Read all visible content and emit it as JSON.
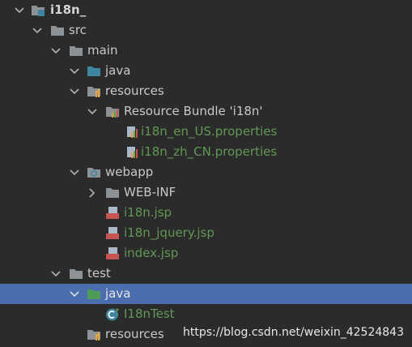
{
  "project_tree": {
    "root": "i18n_",
    "src": "src",
    "main": "main",
    "main_java": "java",
    "main_resources": "resources",
    "bundle": "Resource Bundle 'i18n'",
    "bundle_en": "i18n_en_US.properties",
    "bundle_zh": "i18n_zh_CN.properties",
    "webapp": "webapp",
    "web_inf": "WEB-INF",
    "jsp_i18n": "i18n.jsp",
    "jsp_jquery": "i18n_jquery.jsp",
    "jsp_index": "index.jsp",
    "test": "test",
    "test_java": "java",
    "test_class": "I18nTest",
    "test_resources": "resources",
    "jsp_badge": "JSP"
  },
  "watermark": "https://blog.csdn.net/weixin_42524843",
  "colors": {
    "background": "#2b2b2b",
    "selection": "#4b6eaf",
    "text": "#c8c8c8",
    "file_green": "#629755",
    "folder_gray": "#8c9296",
    "folder_blue": "#3e86a0",
    "folder_green": "#4e9a57",
    "jsp_red": "#c75450"
  }
}
